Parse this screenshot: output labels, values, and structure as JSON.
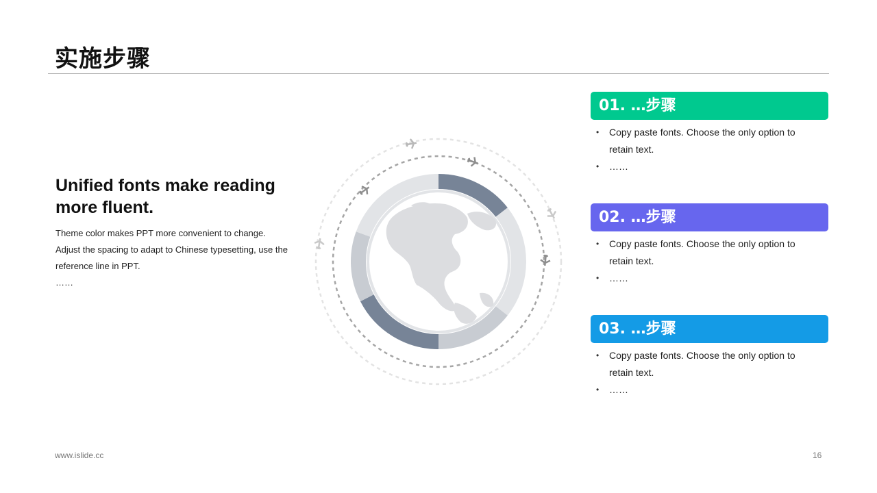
{
  "header": {
    "title": "实施步骤"
  },
  "intro": {
    "headline": "Unified fonts make reading\n more fluent.",
    "body": "Theme color makes PPT more convenient  to change.\nAdjust the spacing to adapt to Chinese  typesetting, use the reference line in PPT.\n……"
  },
  "steps": [
    {
      "title": "01. …步骤",
      "color": "#00c98f",
      "bullets": [
        "Copy paste fonts. Choose the only option to retain text.",
        "……"
      ]
    },
    {
      "title": "02. …步骤",
      "color": "#6766ee",
      "bullets": [
        "Copy paste fonts. Choose the only option to retain text.",
        "……"
      ]
    },
    {
      "title": "03. …步骤",
      "color": "#149be6",
      "bullets": [
        "Copy paste fonts. Choose the only option to retain text.",
        "……"
      ]
    }
  ],
  "graphic": {
    "ring_colors": {
      "dark": "#778497",
      "light": "#c8ccd2",
      "lighter": "#e2e4e7",
      "globe": "#dcdde0"
    },
    "icons": [
      "globe-icon",
      "airplane-icon"
    ]
  },
  "footer": {
    "url": "www.islide.cc",
    "page": "16"
  }
}
